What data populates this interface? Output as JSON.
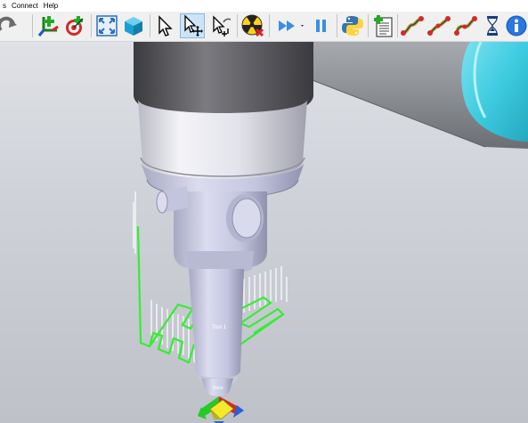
{
  "menu": {
    "items": [
      {
        "label": "s"
      },
      {
        "label": "Connect"
      },
      {
        "label": "Help"
      }
    ]
  },
  "toolbar": {
    "buttons": [
      {
        "name": "redo-icon"
      },
      {
        "name": "add-reference-frame-icon"
      },
      {
        "name": "add-target-icon"
      },
      {
        "name": "fit-all-icon"
      },
      {
        "name": "add-object-icon"
      },
      {
        "name": "select-icon"
      },
      {
        "name": "select-move-icon"
      },
      {
        "name": "select-rotate-icon"
      },
      {
        "name": "radiation-collision-icon"
      },
      {
        "name": "fast-forward-icon"
      },
      {
        "name": "pause-icon"
      },
      {
        "name": "python-icon"
      },
      {
        "name": "add-program-icon"
      },
      {
        "name": "move-joint-icon"
      },
      {
        "name": "move-linear-icon"
      },
      {
        "name": "move-circular-icon"
      },
      {
        "name": "pause-hourglass-icon"
      },
      {
        "name": "info-icon"
      }
    ]
  },
  "viewport": {
    "tool_label": "Tool 1",
    "frame_label": "Base"
  },
  "colors": {
    "robot_cyan": "#4fd3e6",
    "path_green": "#33ee33",
    "arm_grey": "#8a8d92"
  }
}
